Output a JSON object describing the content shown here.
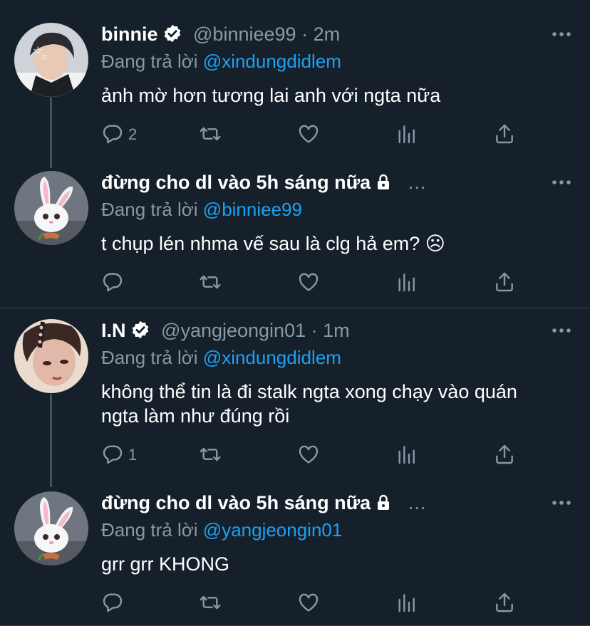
{
  "tweets": [
    {
      "name": "binnie",
      "verified": true,
      "protected": false,
      "handle": "@binniee99",
      "separator": "·",
      "time": "2m",
      "replying_label": "Đang trả lời",
      "replying_to": "@xindungdidlem",
      "text": "ảnh mờ hơn tương lai anh với ngta nữa",
      "reply_count": "2",
      "avatar_icon": "profile-photo"
    },
    {
      "name": "đừng cho dl vào 5h sáng nữa",
      "verified": false,
      "protected": true,
      "handle": "…",
      "separator": "",
      "time": "",
      "replying_label": "Đang trả lời",
      "replying_to": "@binniee99",
      "text": "t chụp lén nhma vế sau là clg hả em? ☹",
      "reply_count": "",
      "avatar_icon": "white-bunny"
    },
    {
      "name": "I.N",
      "verified": true,
      "protected": false,
      "handle": "@yangjeongin01",
      "separator": "·",
      "time": "1m",
      "replying_label": "Đang trả lời",
      "replying_to": "@xindungdidlem",
      "text": "không thể tin là đi stalk ngta xong chạy vào quán\nngta làm như đúng rồi",
      "reply_count": "1",
      "avatar_icon": "profile-photo"
    },
    {
      "name": "đừng cho dl vào 5h sáng nữa",
      "verified": false,
      "protected": true,
      "handle": "…",
      "separator": "",
      "time": "",
      "replying_label": "Đang trả lời",
      "replying_to": "@yangjeongin01",
      "text": "grr grr KHONG",
      "reply_count": "",
      "avatar_icon": "white-bunny"
    }
  ],
  "colors": {
    "background": "#15202b",
    "secondary_text": "#8899a6",
    "link": "#1da1f2",
    "divider": "#38444d",
    "thread_line": "#3d5466"
  }
}
